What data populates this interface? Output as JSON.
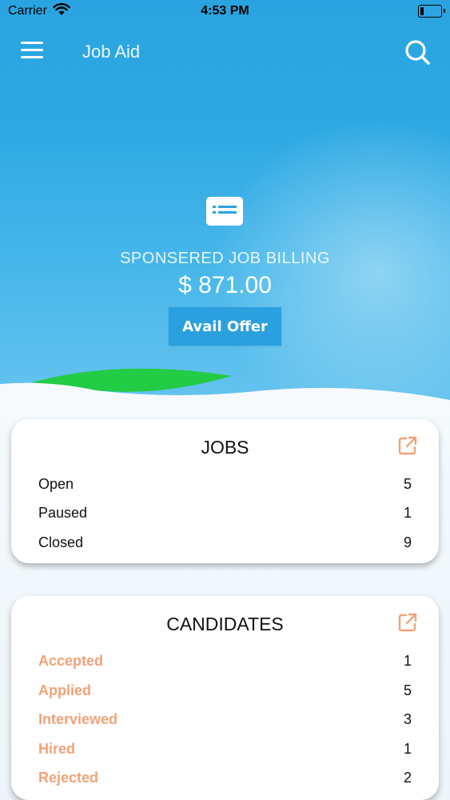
{
  "status_bar": {
    "carrier": "Carrier",
    "time": "4:53 PM"
  },
  "nav": {
    "title": "Job Aid",
    "menu_icon": "hamburger-menu-icon",
    "search_icon": "search-icon"
  },
  "billing": {
    "icon": "billing-card-icon",
    "label": "SPONSERED JOB BILLING",
    "amount": "$ 871.00",
    "offer_button": "Avail Offer"
  },
  "jobs": {
    "title": "JOBS",
    "icon": "external-link-icon",
    "rows": [
      {
        "label": "Open",
        "value": "5"
      },
      {
        "label": "Paused",
        "value": "1"
      },
      {
        "label": "Closed",
        "value": "9"
      }
    ]
  },
  "candidates": {
    "title": "CANDIDATES",
    "icon": "external-link-icon",
    "rows": [
      {
        "label": "Accepted",
        "value": "1"
      },
      {
        "label": "Applied",
        "value": "5"
      },
      {
        "label": "Interviewed",
        "value": "3"
      },
      {
        "label": "Hired",
        "value": "1"
      },
      {
        "label": "Rejected",
        "value": "2"
      }
    ]
  },
  "colors": {
    "primary": "#29a4e0",
    "accent": "#f2a277",
    "wave_green": "#22cc44"
  }
}
